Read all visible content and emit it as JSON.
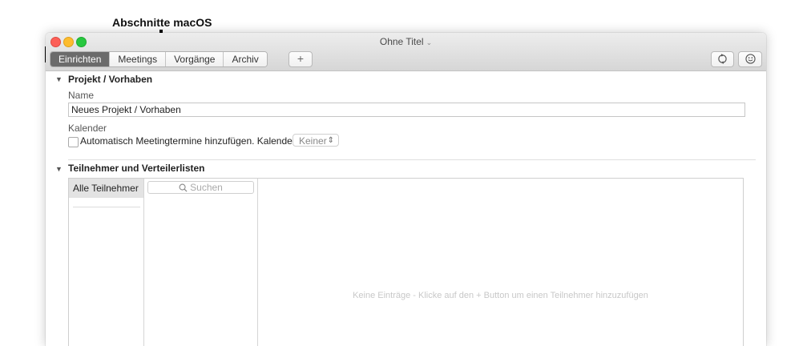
{
  "annotation": {
    "label": "Abschnitte macOS"
  },
  "window": {
    "title": "Ohne Titel",
    "title_chevron": "⌄"
  },
  "toolbar": {
    "segments": [
      "Einrichten",
      "Meetings",
      "Vorgänge",
      "Archiv"
    ],
    "active_segment": "Einrichten",
    "add_label": "+",
    "icons": [
      "sync-icon",
      "smiley-icon"
    ]
  },
  "project": {
    "section_title": "Projekt / Vorhaben",
    "name_label": "Name",
    "name_value": "Neues Projekt / Vorhaben",
    "calendar_label": "Kalender",
    "checkbox_label": "Automatisch Meetingtermine hinzufügen. Kalender:",
    "checkbox_checked": false,
    "calendar_select": "Keiner"
  },
  "participants": {
    "section_title": "Teilnehmer und Verteilerlisten",
    "list_item": "Alle Teilnehmer",
    "search_placeholder": "Suchen",
    "empty_message": "Keine Einträge - Klicke auf den + Button um einen Teilnehmer hinzuzufügen"
  }
}
